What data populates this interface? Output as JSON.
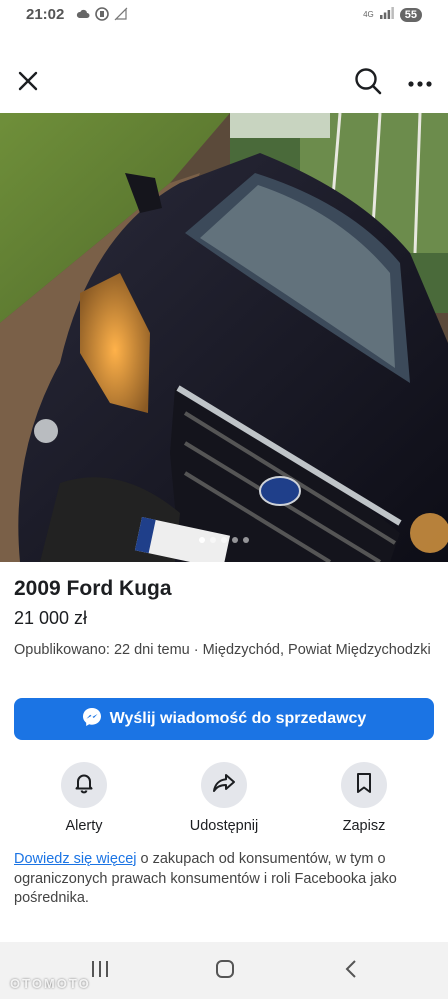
{
  "status_bar": {
    "time": "21:02",
    "network": "4G",
    "battery": "55"
  },
  "listing": {
    "title": "2009 Ford Kuga",
    "price": "21 000 zł",
    "meta": "Opublikowano: 22 dni temu · Międzychód, Powiat Międzychodzki",
    "photo_count": 5,
    "photo_active_index": 0
  },
  "message_button": {
    "label": "Wyślij wiadomość do sprzedawcy"
  },
  "actions": [
    {
      "label": "Alerty",
      "icon": "bell-icon"
    },
    {
      "label": "Udostępnij",
      "icon": "share-icon"
    },
    {
      "label": "Zapisz",
      "icon": "bookmark-icon"
    }
  ],
  "note": {
    "link": "Dowiedz się więcej",
    "text": " o zakupach od konsumentów, w tym o ograniczonych prawach konsumentów i roli Facebooka jako pośrednika."
  },
  "watermark": "OTOMOTO",
  "colors": {
    "accent": "#1b74e4",
    "button_bg": "#e4e6eb"
  }
}
